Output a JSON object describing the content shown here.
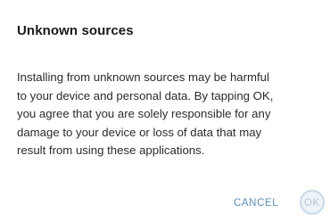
{
  "dialog": {
    "title": "Unknown sources",
    "message_lines": [
      "Installing from unknown sources may be harmful",
      "to your device and personal data. By tapping OK,",
      "you agree that you are solely responsible for any",
      "damage to your device or loss of data that may",
      "result from using these applications."
    ],
    "cancel_label": "CANCEL",
    "ok_label": "OK"
  },
  "colors": {
    "accent": "#5d8fb6",
    "background": "#ffffff",
    "text": "#212121"
  }
}
